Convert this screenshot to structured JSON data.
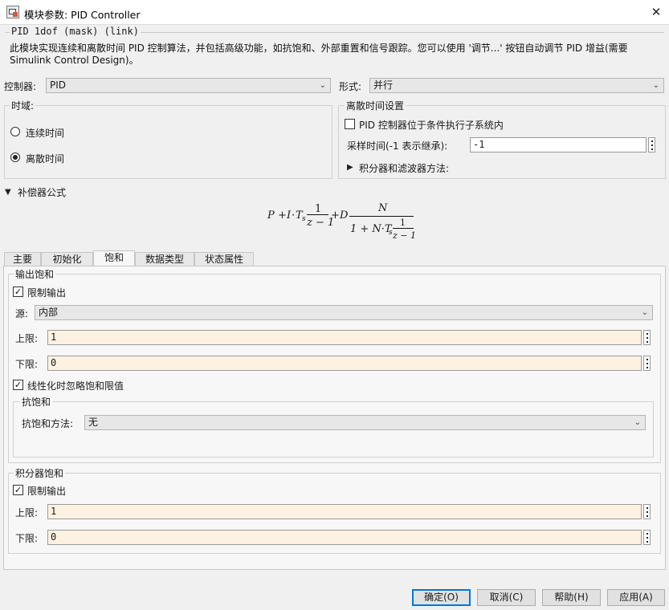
{
  "window": {
    "title": "模块参数: PID Controller",
    "close_glyph": "✕"
  },
  "mask": {
    "legend": "PID 1dof (mask) (link)",
    "description": "此模块实现连续和离散时间 PID 控制算法，并包括高级功能，如抗饱和、外部重置和信号跟踪。您可以使用 '调节...' 按钮自动调节 PID 增益(需要 Simulink Control Design)。"
  },
  "controller": {
    "label": "控制器:",
    "value": "PID"
  },
  "form": {
    "label": "形式:",
    "value": "并行"
  },
  "time_domain": {
    "legend": "时域:",
    "options": [
      {
        "label": "连续时间",
        "selected": false
      },
      {
        "label": "离散时间",
        "selected": true
      }
    ]
  },
  "discrete_settings": {
    "legend": "离散时间设置",
    "conditional_label": "PID 控制器位于条件执行子系统内",
    "conditional_checked": false,
    "sample_time_label": "采样时间(-1 表示继承):",
    "sample_time_value": "-1",
    "integrator_method_label": "积分器和滤波器方法:"
  },
  "compensator": {
    "label": "补偿器公式",
    "formula": {
      "P": "P",
      "plus": "+",
      "I": "I",
      "dot": "·",
      "T": "T",
      "s": "s",
      "one": "1",
      "z_minus_1": "z − 1",
      "D": "D",
      "N": "N",
      "den_prefix": "1 + N·T"
    }
  },
  "tabs": [
    {
      "label": "主要",
      "active": false
    },
    {
      "label": "初始化",
      "active": false
    },
    {
      "label": "饱和",
      "active": true
    },
    {
      "label": "数据类型",
      "active": false
    },
    {
      "label": "状态属性",
      "active": false
    }
  ],
  "output_saturation": {
    "legend": "输出饱和",
    "limit_label": "限制输出",
    "limit_checked": true,
    "source_label": "源:",
    "source_value": "内部",
    "upper_label": "上限:",
    "upper_value": "1",
    "lower_label": "下限:",
    "lower_value": "0",
    "ignore_label": "线性化时忽略饱和限值",
    "ignore_checked": true,
    "anti_windup": {
      "legend": "抗饱和",
      "method_label": "抗饱和方法:",
      "method_value": "无"
    }
  },
  "integrator_saturation": {
    "legend": "积分器饱和",
    "limit_label": "限制输出",
    "limit_checked": true,
    "upper_label": "上限:",
    "upper_value": "1",
    "lower_label": "下限:",
    "lower_value": "0"
  },
  "buttons": {
    "ok": "确定(O)",
    "cancel": "取消(C)",
    "help": "帮助(H)",
    "apply": "应用(A)"
  },
  "colors": {
    "required_field_bg": "#fdf2e2",
    "default_button_border": "#0078d7",
    "panel_bg": "#f7f7f7",
    "dialog_bg": "#f0f0f0"
  }
}
